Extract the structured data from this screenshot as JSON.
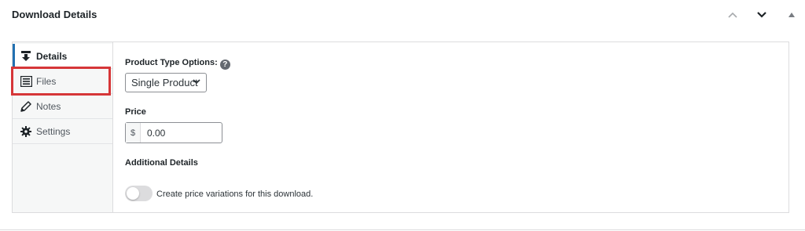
{
  "header": {
    "title": "Download Details",
    "icons": [
      "chevron-up-icon",
      "chevron-down-icon",
      "triangle-up-icon"
    ]
  },
  "sidebar": {
    "tabs": [
      {
        "label": "Details",
        "icon": "download-icon",
        "active": true
      },
      {
        "label": "Files",
        "icon": "list-icon",
        "active": false
      },
      {
        "label": "Notes",
        "icon": "pencil-icon",
        "active": false
      },
      {
        "label": "Settings",
        "icon": "gear-icon",
        "active": false
      }
    ]
  },
  "main": {
    "product_type_label": "Product Type Options:",
    "product_type_selected": "Single Product",
    "price_label": "Price",
    "currency_symbol": "$",
    "price_value": "0.00",
    "additional_details_label": "Additional Details",
    "variations_toggle_label": "Create price variations for this download.",
    "variations_toggle_on": false
  },
  "colors": {
    "accent": "#2271b1",
    "highlight": "#d63638",
    "sidebar_bg": "#f6f7f7"
  }
}
